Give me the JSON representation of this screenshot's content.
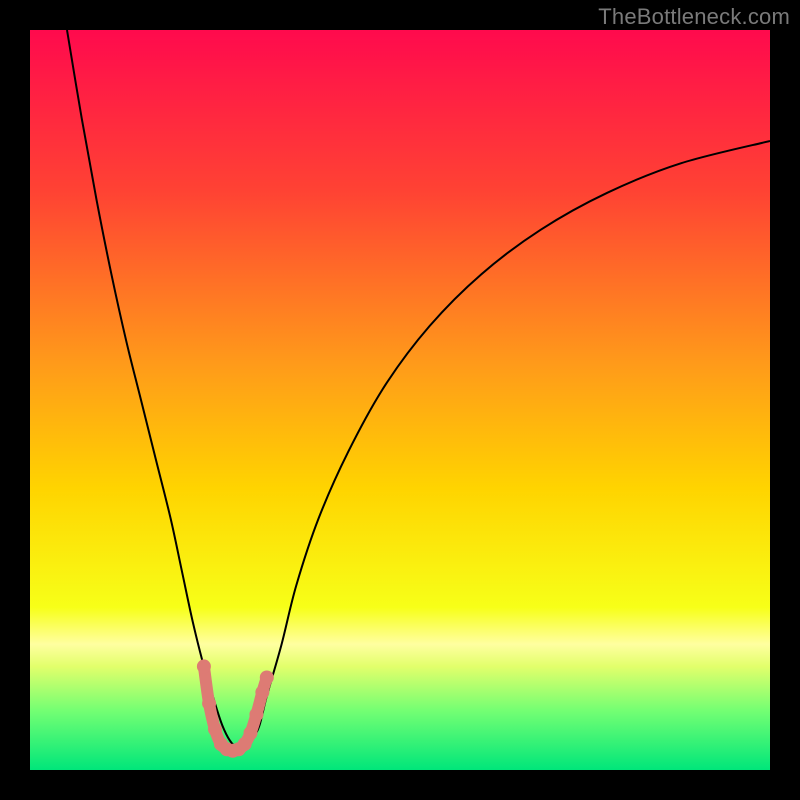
{
  "watermark": "TheBottleneck.com",
  "chart_data": {
    "type": "line",
    "title": "",
    "xlabel": "",
    "ylabel": "",
    "xlim": [
      0,
      100
    ],
    "ylim": [
      0,
      100
    ],
    "grid": false,
    "legend": false,
    "background_gradient_stops": [
      {
        "pct": 0,
        "color": "#ff0a4d"
      },
      {
        "pct": 22,
        "color": "#ff4333"
      },
      {
        "pct": 45,
        "color": "#ff9a1a"
      },
      {
        "pct": 62,
        "color": "#ffd400"
      },
      {
        "pct": 78,
        "color": "#f7ff18"
      },
      {
        "pct": 83,
        "color": "#ffffa0"
      },
      {
        "pct": 86,
        "color": "#e2ff6b"
      },
      {
        "pct": 92,
        "color": "#73ff73"
      },
      {
        "pct": 100,
        "color": "#00e67a"
      }
    ],
    "series": [
      {
        "name": "bottleneck-curve",
        "color": "#000000",
        "x": [
          5,
          7,
          9,
          11,
          13,
          15,
          17,
          19,
          20.5,
          22,
          23.5,
          25,
          26,
          27,
          28,
          29,
          30,
          31,
          32,
          34,
          36,
          39,
          43,
          48,
          54,
          61,
          69,
          78,
          88,
          100
        ],
        "y": [
          100,
          88,
          77,
          67,
          58,
          50,
          42,
          34,
          27,
          20,
          14,
          9,
          6,
          4,
          3,
          3,
          4,
          6,
          10,
          17,
          25,
          34,
          43,
          52,
          60,
          67,
          73,
          78,
          82,
          85
        ]
      },
      {
        "name": "optimal-zone-marker",
        "color": "#dd7b74",
        "x": [
          23.5,
          24.2,
          25.0,
          25.8,
          26.6,
          27.4,
          28.2,
          29.0,
          29.8,
          30.6,
          31.4,
          32.0
        ],
        "y": [
          14,
          9,
          5.5,
          3.5,
          2.8,
          2.6,
          2.8,
          3.5,
          5.0,
          7.5,
          10.5,
          12.5
        ]
      }
    ]
  }
}
